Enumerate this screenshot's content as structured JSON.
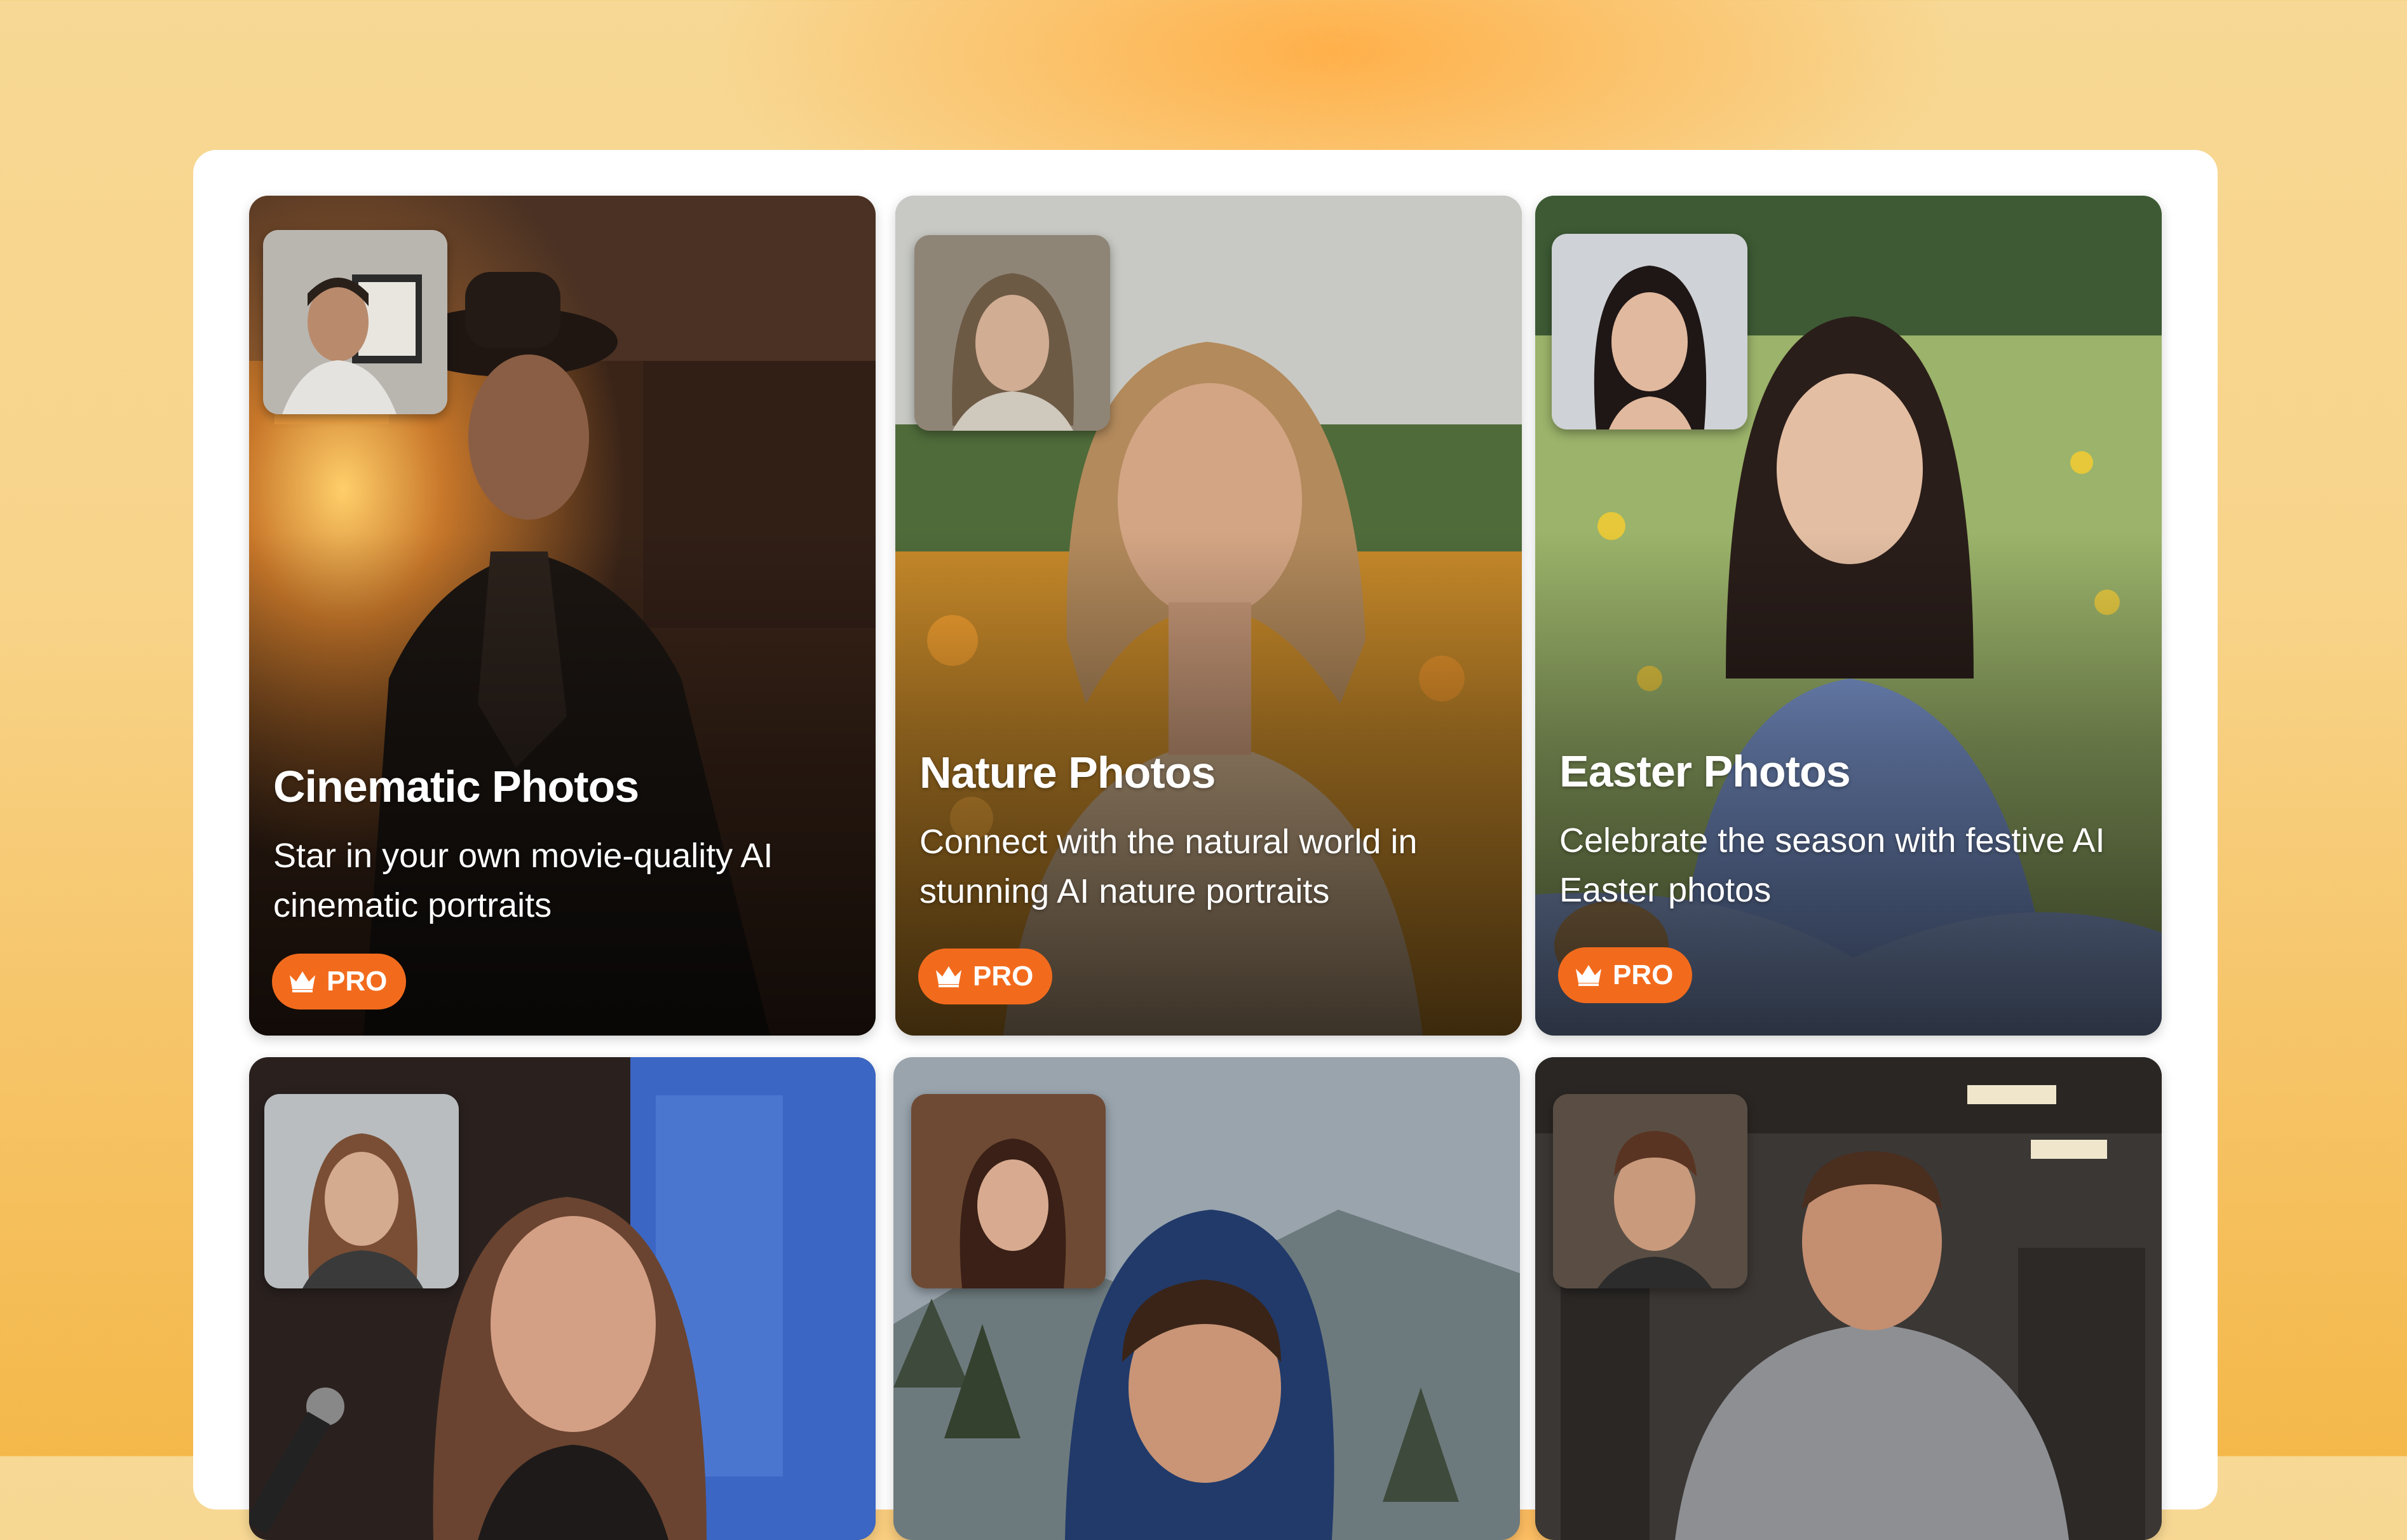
{
  "colors": {
    "accent": "#f26b1d",
    "panel": "#ffffff"
  },
  "cards": [
    {
      "title": "Cinematic Photos",
      "description": "Star in your own movie-quality AI cinematic portraits",
      "badge": "PRO",
      "badge_icon": "crown-icon"
    },
    {
      "title": "Nature Photos",
      "description": "Connect with the natural world in stunning AI nature portraits",
      "badge": "PRO",
      "badge_icon": "crown-icon"
    },
    {
      "title": "Easter Photos",
      "description": "Celebrate the season with festive AI Easter photos",
      "badge": "PRO",
      "badge_icon": "crown-icon"
    },
    {
      "title": "",
      "description": ""
    },
    {
      "title": "",
      "description": ""
    },
    {
      "title": "",
      "description": ""
    }
  ]
}
